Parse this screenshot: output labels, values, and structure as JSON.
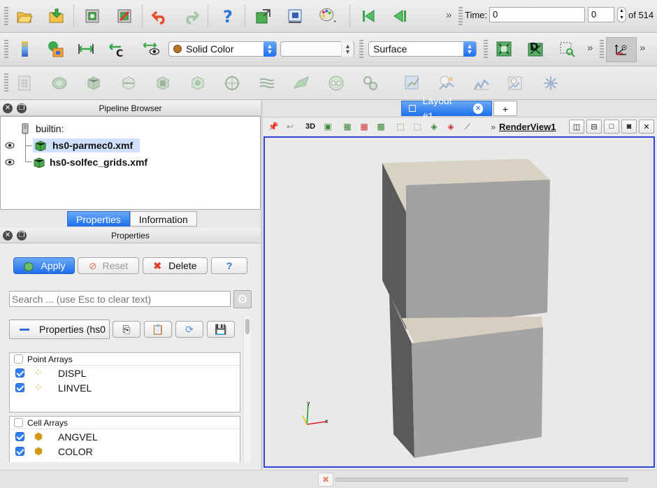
{
  "main_toolbar": {
    "time_label": "Time:",
    "time_value": "0",
    "timestep_value": "0",
    "timestep_total": "of 514",
    "icons": [
      "open-file-icon",
      "load-data-icon",
      "connect-icon",
      "disconnect-icon",
      "undo-icon",
      "redo-icon",
      "help-icon",
      "save-state-icon",
      "screenshot-icon",
      "palette-icon",
      "first-frame-icon",
      "prev-frame-icon"
    ]
  },
  "display_toolbar": {
    "coloring_value": "Solid Color",
    "component_value": "",
    "representation_value": "Surface"
  },
  "pipeline_browser": {
    "title": "Pipeline Browser",
    "root_label": "builtin:",
    "items": [
      {
        "label": "hs0-parmec0.xmf",
        "selected": true
      },
      {
        "label": "hs0-solfec_grids.xmf",
        "selected": false
      }
    ]
  },
  "panel_tabs": {
    "properties_tab": "Properties",
    "information_tab": "Information"
  },
  "properties_panel": {
    "title": "Properties",
    "apply_label": "Apply",
    "reset_label": "Reset",
    "delete_label": "Delete",
    "help_label": "?",
    "search_placeholder": "Search ... (use Esc to clear text)",
    "section_label": "Properties (hs0",
    "point_arrays_header": "Point Arrays",
    "point_arrays": [
      {
        "label": "DISPL",
        "checked": true
      },
      {
        "label": "LINVEL",
        "checked": true
      }
    ],
    "cell_arrays_header": "Cell Arrays",
    "cell_arrays": [
      {
        "label": "ANGVEL",
        "checked": true
      },
      {
        "label": "COLOR",
        "checked": true
      }
    ]
  },
  "layout": {
    "tab_label": "Layout #1",
    "add_tab_label": "+",
    "view_label": "RenderView1",
    "mode_3d_label": "3D"
  },
  "colors": {
    "accent": "#1f72ee",
    "viewport_border": "#2f45d9",
    "cube_front": "#a2a2a2",
    "cube_side": "#5a5a5a",
    "cube_top": "#d8d2c3"
  }
}
